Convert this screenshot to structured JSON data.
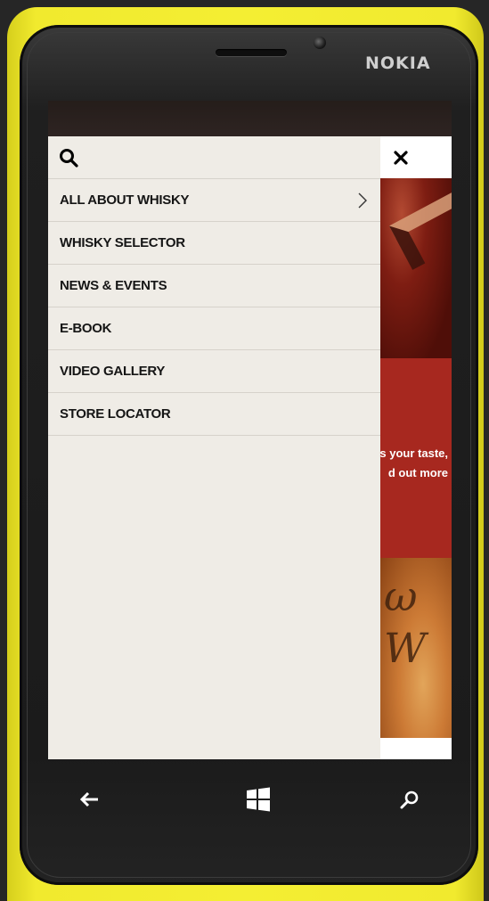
{
  "device": {
    "brand": "NOKIA"
  },
  "menu": {
    "items": [
      {
        "label": "ALL ABOUT WHISKY",
        "has_submenu": true
      },
      {
        "label": "WHISKY SELECTOR",
        "has_submenu": false
      },
      {
        "label": "NEWS & EVENTS",
        "has_submenu": false
      },
      {
        "label": "E-BOOK",
        "has_submenu": false
      },
      {
        "label": "VIDEO GALLERY",
        "has_submenu": false
      },
      {
        "label": "STORE LOCATOR",
        "has_submenu": false
      }
    ]
  },
  "background_content": {
    "promo_line1": "s your taste,",
    "promo_line2": "d out more"
  },
  "icons": {
    "search": "search-icon",
    "close": "close-icon",
    "submenu": "chevron-right-icon",
    "nav_back": "back-arrow-icon",
    "nav_start": "windows-start-icon",
    "nav_search": "search-icon"
  },
  "colors": {
    "shell": "#f4ee33",
    "drawer": "#efece6",
    "promo_red": "#a7281f",
    "status_bar": "#2e2422"
  }
}
